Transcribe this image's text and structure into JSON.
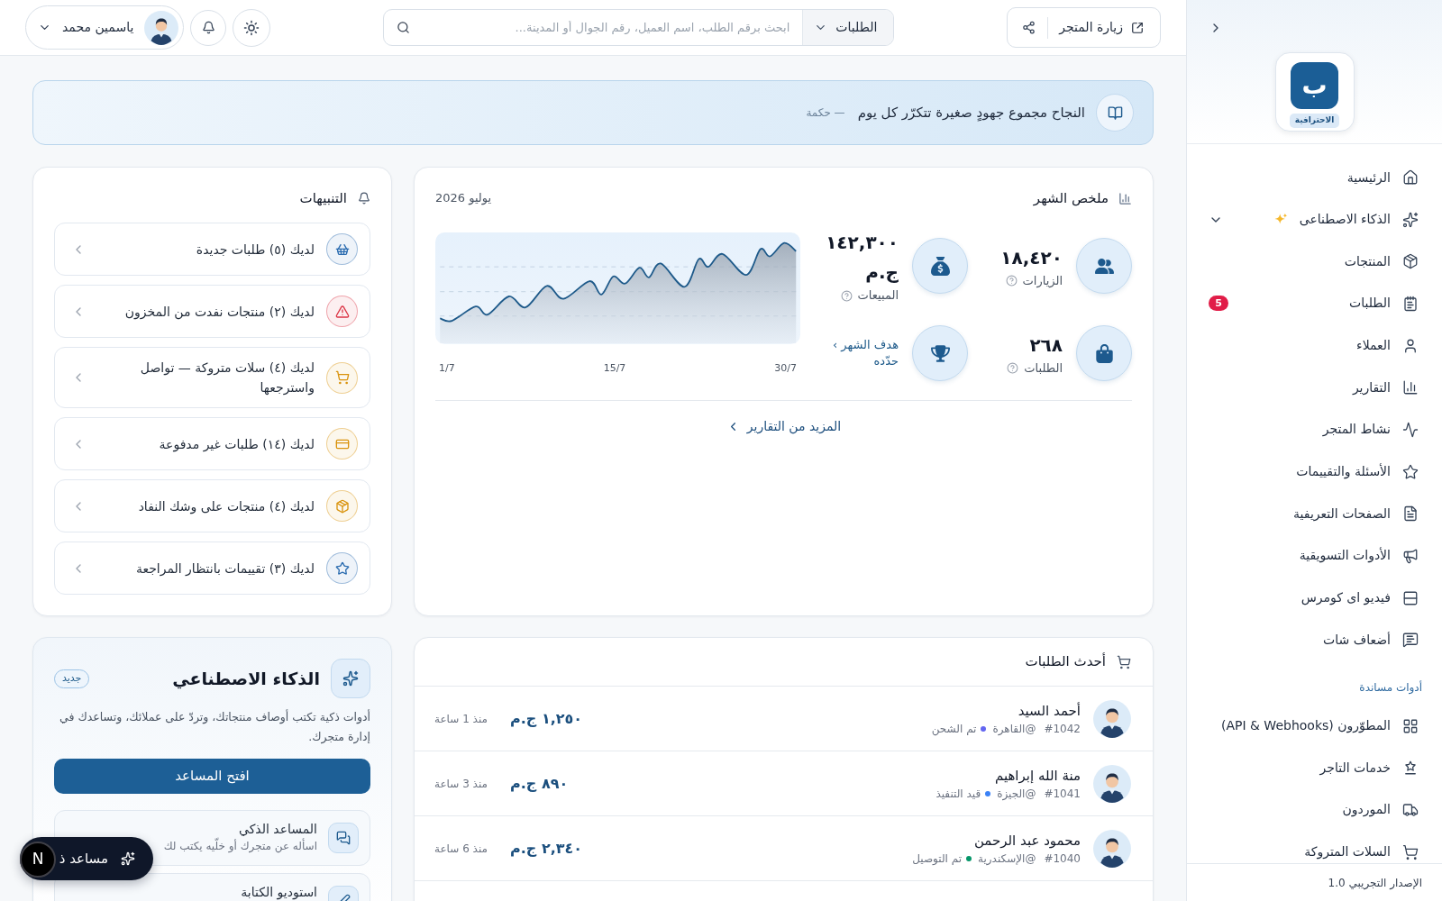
{
  "sidebar": {
    "logo": {
      "letter": "ب",
      "label": "الاحترافية"
    },
    "items": [
      {
        "kind": "home",
        "label": "الرئيسية",
        "selected": false
      },
      {
        "kind": "ai",
        "label": "الذكاء الاصطناعى",
        "selected": false,
        "expanded": false
      },
      {
        "kind": "products",
        "label": "المنتجات",
        "selected": false
      },
      {
        "kind": "orders",
        "label": "الطلبات",
        "selected": false,
        "badge": "5"
      },
      {
        "kind": "customers",
        "label": "العملاء",
        "selected": false
      },
      {
        "kind": "reports",
        "label": "التقارير",
        "selected": false
      },
      {
        "kind": "activity",
        "label": "نشاط المتجر",
        "selected": false
      },
      {
        "kind": "reviews",
        "label": "الأسئلة والتقييمات",
        "selected": false
      },
      {
        "kind": "pages",
        "label": "الصفحات التعريفية",
        "selected": false
      },
      {
        "kind": "marketing",
        "label": "الأدوات التسويقية",
        "selected": false
      },
      {
        "kind": "video",
        "label": "فيديو اى كومرس",
        "selected": false
      },
      {
        "kind": "chat",
        "label": "أضعاف شات",
        "selected": false
      }
    ],
    "tools": {
      "title": "أدوات مساندة",
      "items": [
        {
          "kind": "developers",
          "label": "المطوّرون (API & Webhooks)",
          "selected": false
        },
        {
          "kind": "services",
          "label": "خدمات التاجر",
          "selected": false
        },
        {
          "kind": "suppliers",
          "label": "الموردون",
          "selected": false
        },
        {
          "kind": "carts",
          "label": "السلات المتروكة",
          "selected": false
        }
      ]
    },
    "version": "الإصدار التجريبي 1.0"
  },
  "topbar": {
    "visit_store": "زيارة المتجر",
    "search": {
      "scope": "الطلبات",
      "placeholder": "ابحث برقم الطلب، اسم العميل، رقم الجوال أو المدينة..."
    },
    "user": {
      "name": "ياسمين محمد"
    }
  },
  "quote": {
    "text": "النجاح مجموع جهودٍ صغيرة تتكرّر كل يوم",
    "source": "— حكمة"
  },
  "summary": {
    "title": "ملخص الشهر",
    "period": "يوليو 2026",
    "stats": [
      {
        "kind": "visits",
        "value": "١٨,٤٢٠",
        "label": "الزيارات"
      },
      {
        "kind": "orders",
        "value": "٢٦٨",
        "label": "الطلبات"
      },
      {
        "kind": "sales",
        "value": "١٤٢,٣٠٠ ج.م",
        "label": "المبيعات"
      },
      {
        "kind": "goal",
        "link": "هدف الشهر › حدّده"
      }
    ],
    "chart": {
      "x_labels": [
        "30/7",
        "15/7",
        "1/7"
      ]
    },
    "more_link": "المزيد من التقارير"
  },
  "alerts": {
    "title": "التنبيهات",
    "items": [
      {
        "kind": "new_orders",
        "text": "لديك (٥) طلبات جديدة",
        "color": "#2b6cb0"
      },
      {
        "kind": "out_of_stock",
        "text": "لديك (٢) منتجات نفدت من المخزون",
        "color": "#dc3545"
      },
      {
        "kind": "abandoned_carts",
        "text": "لديك (٤) سلات متروكة — تواصل واسترجعها",
        "color": "#d9930d"
      },
      {
        "kind": "unpaid",
        "text": "لديك (١٤) طلبات غير مدفوعة",
        "color": "#d9930d"
      },
      {
        "kind": "low_stock",
        "text": "لديك (٤) منتجات على وشك النفاد",
        "color": "#d9930d"
      },
      {
        "kind": "reviews",
        "text": "لديك (٣) تقييمات بانتظار المراجعة",
        "color": "#2b6cb0"
      }
    ]
  },
  "ai": {
    "title": "الذكاء الاصطناعي",
    "badge": "جديد",
    "description": "أدوات ذكية تكتب أوصاف منتجاتك، وتردّ على عملائك، وتساعدك في إدارة متجرك.",
    "button": "افتح المساعد",
    "tools": [
      {
        "kind": "assistant",
        "title": "المساعد الذكي",
        "subtitle": "اسأله عن متجرك أو خلّيه يكتب لك"
      },
      {
        "kind": "studio",
        "title": "استوديو الكتابة"
      }
    ]
  },
  "recent_orders": {
    "title": "أحدث الطلبات",
    "rows": [
      {
        "name": "أحمد السيد",
        "number": "#1042",
        "city": "@القاهرة",
        "status": "تم الشحن",
        "color": "#6366f1",
        "amount": "١,٢٥٠ ج.م",
        "time": "منذ 1 ساعة"
      },
      {
        "name": "منة الله إبراهيم",
        "number": "#1041",
        "city": "@الجيزة",
        "status": "قيد التنفيذ",
        "color": "#3b82f6",
        "amount": "٨٩٠ ج.م",
        "time": "منذ 3 ساعة"
      },
      {
        "name": "محمود عبد الرحمن",
        "number": "#1040",
        "city": "@الإسكندرية",
        "status": "تم التوصيل",
        "color": "#059669",
        "amount": "٢,٣٤٠ ج.م",
        "time": "منذ 6 ساعة"
      }
    ]
  },
  "floating_assistant": {
    "label": "مساعد ذ"
  },
  "dev_indicator": {
    "label": "N"
  }
}
